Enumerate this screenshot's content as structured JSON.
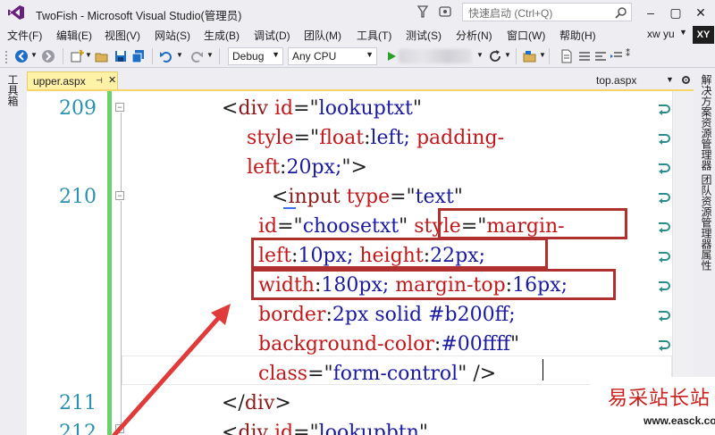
{
  "window": {
    "title": "TwoFish - Microsoft Visual Studio(管理员)",
    "quick_launch_placeholder": "快速启动 (Ctrl+Q)",
    "min": "–",
    "max": "▢",
    "close": "✕"
  },
  "menu": {
    "items": [
      "文件(F)",
      "编辑(E)",
      "视图(V)",
      "网站(S)",
      "生成(B)",
      "调试(D)",
      "团队(M)",
      "工具(T)",
      "测试(S)",
      "分析(N)",
      "窗口(W)",
      "帮助(H)"
    ],
    "user": "xw yu",
    "avatar": "XY"
  },
  "toolbar": {
    "config": "Debug",
    "platform": "Any CPU"
  },
  "left_panel": {
    "tab": "工具箱"
  },
  "right_panel": {
    "tabs": [
      "解决方案资源管理器",
      "团队资源管理器",
      "属性"
    ]
  },
  "tabs": {
    "active": "upper.aspx",
    "pin": "⊣",
    "close": "✕",
    "other": "top.aspx"
  },
  "editor": {
    "lines": [
      {
        "num": "209",
        "parts": [
          [
            "t-punct",
            "<"
          ],
          [
            "t-tag",
            "div "
          ],
          [
            "t-attr",
            "id"
          ],
          [
            "t-punct",
            "=\""
          ],
          [
            "t-val",
            "lookuptxt"
          ],
          [
            "t-punct",
            "\""
          ]
        ]
      },
      {
        "num": "",
        "parts": [
          [
            "t-attr",
            "style"
          ],
          [
            "t-punct",
            "=\""
          ],
          [
            "t-attr",
            "float"
          ],
          [
            "t-punct",
            ":"
          ],
          [
            "t-val",
            "left; "
          ],
          [
            "t-attr",
            "padding-"
          ]
        ]
      },
      {
        "num": "",
        "parts": [
          [
            "t-attr",
            "left"
          ],
          [
            "t-punct",
            ":"
          ],
          [
            "t-val",
            "20px;"
          ],
          [
            "t-punct",
            "\">"
          ]
        ]
      },
      {
        "num": "210",
        "parts": [
          [
            "t-punct",
            "<"
          ],
          [
            "t-tag",
            "input "
          ],
          [
            "t-attr",
            "type"
          ],
          [
            "t-punct",
            "=\""
          ],
          [
            "t-val",
            "text"
          ],
          [
            "t-punct",
            "\""
          ]
        ]
      },
      {
        "num": "",
        "parts": [
          [
            "t-attr",
            "id"
          ],
          [
            "t-punct",
            "=\""
          ],
          [
            "t-val",
            "choosetxt"
          ],
          [
            "t-punct",
            "\" "
          ],
          [
            "t-attr",
            "style"
          ],
          [
            "t-punct",
            "=\""
          ],
          [
            "t-attr",
            "margin-"
          ]
        ]
      },
      {
        "num": "",
        "parts": [
          [
            "t-attr",
            "left"
          ],
          [
            "t-punct",
            ":"
          ],
          [
            "t-val",
            "10px; "
          ],
          [
            "t-attr",
            "height"
          ],
          [
            "t-punct",
            ":"
          ],
          [
            "t-val",
            "22px;"
          ]
        ]
      },
      {
        "num": "",
        "parts": [
          [
            "t-attr",
            "width"
          ],
          [
            "t-punct",
            ":"
          ],
          [
            "t-val",
            "180px; "
          ],
          [
            "t-attr",
            "margin-top"
          ],
          [
            "t-punct",
            ":"
          ],
          [
            "t-val",
            "16px;"
          ]
        ]
      },
      {
        "num": "",
        "parts": [
          [
            "t-attr",
            "border"
          ],
          [
            "t-punct",
            ":"
          ],
          [
            "t-val",
            "2px solid #b200ff;"
          ]
        ]
      },
      {
        "num": "",
        "parts": [
          [
            "t-attr",
            "background-color"
          ],
          [
            "t-punct",
            ":"
          ],
          [
            "t-val",
            "#00ffff"
          ],
          [
            "t-punct",
            "\""
          ]
        ]
      },
      {
        "num": "",
        "parts": [
          [
            "t-attr",
            "class"
          ],
          [
            "t-punct",
            "=\""
          ],
          [
            "t-val",
            "form-control"
          ],
          [
            "t-punct",
            "\" />"
          ]
        ]
      },
      {
        "num": "211",
        "parts": [
          [
            "t-punct",
            "</"
          ],
          [
            "t-tag",
            "div"
          ],
          [
            "t-punct",
            ">"
          ]
        ]
      },
      {
        "num": "212",
        "parts": [
          [
            "t-punct",
            "<"
          ],
          [
            "t-tag",
            "div "
          ],
          [
            "t-attr",
            "id"
          ],
          [
            "t-punct",
            "=\""
          ],
          [
            "t-val",
            "lookupbtn"
          ],
          [
            "t-punct",
            "\""
          ]
        ]
      }
    ]
  },
  "watermark": {
    "cn": "易采站长站",
    "url": "www.easck.com"
  },
  "colors": {
    "highlight": "#b03030",
    "arrow": "#e03a3a",
    "changebar": "#6bd16b",
    "linenum": "#2b91af"
  }
}
